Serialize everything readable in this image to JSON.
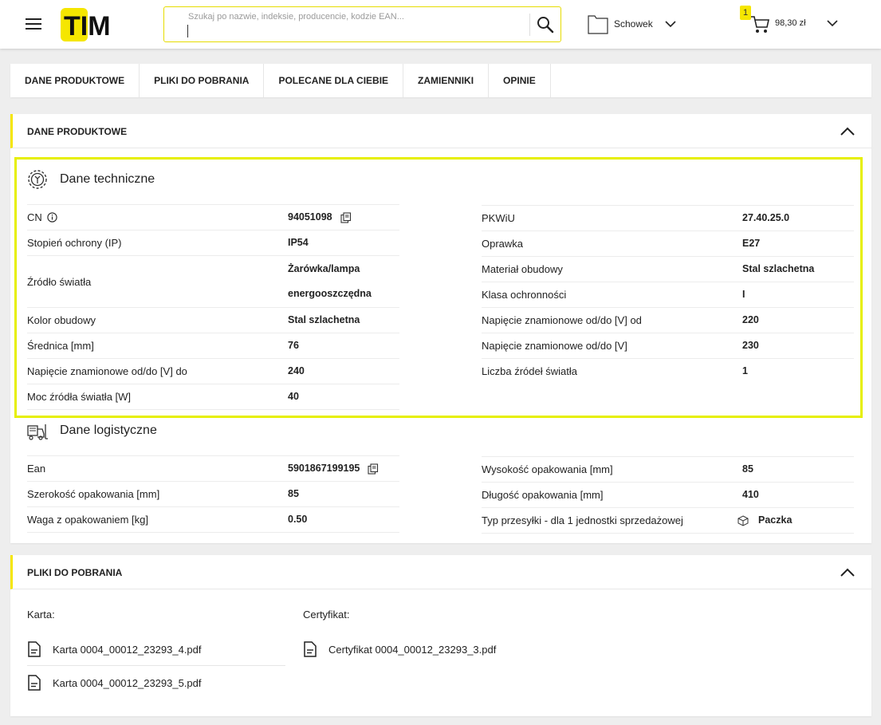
{
  "header": {
    "logo_text": "TIM",
    "search_placeholder": "Szukaj po nazwie, indeksie, producencie, kodzie EAN...",
    "clipboard_label": "Schowek",
    "cart_count": "1",
    "cart_total": "98,30 zł"
  },
  "tabs": [
    {
      "label": "DANE PRODUKTOWE"
    },
    {
      "label": "PLIKI DO POBRANIA"
    },
    {
      "label": "POLECANE DLA CIEBIE"
    },
    {
      "label": "ZAMIENNIKI"
    },
    {
      "label": "OPINIE"
    }
  ],
  "product_section": {
    "title": "DANE PRODUKTOWE",
    "technical": {
      "title": "Dane techniczne",
      "left": [
        {
          "label": "CN",
          "value": "94051098"
        },
        {
          "label": "Stopień ochrony (IP)",
          "value": "IP54"
        },
        {
          "label": "Źródło światła",
          "value": "Żarówka/lampa",
          "value2": "energooszczędna"
        },
        {
          "label": "Kolor obudowy",
          "value": "Stal szlachetna"
        },
        {
          "label": "Średnica [mm]",
          "value": "76"
        },
        {
          "label": "Napięcie znamionowe od/do [V] do",
          "value": "240"
        },
        {
          "label": "Moc źródła światła [W]",
          "value": "40"
        }
      ],
      "right": [
        {
          "label": "PKWiU",
          "value": "27.40.25.0"
        },
        {
          "label": "Oprawka",
          "value": "E27"
        },
        {
          "label": "Materiał obudowy",
          "value": "Stal szlachetna"
        },
        {
          "label": "Klasa ochronności",
          "value": "I"
        },
        {
          "label": "Napięcie znamionowe od/do [V] od",
          "value": "220"
        },
        {
          "label": "Napięcie znamionowe od/do [V]",
          "value": "230"
        },
        {
          "label": "Liczba źródeł światła",
          "value": "1"
        }
      ]
    },
    "logistics": {
      "title": "Dane logistyczne",
      "left": [
        {
          "label": "Ean",
          "value": "5901867199195"
        },
        {
          "label": "Szerokość opakowania [mm]",
          "value": "85"
        },
        {
          "label": "Waga z opakowaniem [kg]",
          "value": "0.50"
        }
      ],
      "right": [
        {
          "label": "Wysokość opakowania [mm]",
          "value": "85"
        },
        {
          "label": "Długość opakowania [mm]",
          "value": "410"
        },
        {
          "label": "Typ przesyłki - dla 1 jednostki sprzedażowej",
          "value": "Paczka"
        }
      ]
    }
  },
  "files_section": {
    "title": "PLIKI DO POBRANIA",
    "karta_label": "Karta:",
    "cert_label": "Certyfikat:",
    "karta_files": [
      "Karta 0004_00012_23293_4.pdf",
      "Karta 0004_00012_23293_5.pdf"
    ],
    "cert_files": [
      "Certyfikat 0004_00012_23293_3.pdf"
    ]
  },
  "colors": {
    "accent": "#f5e600",
    "highlight": "#e6ef00"
  }
}
